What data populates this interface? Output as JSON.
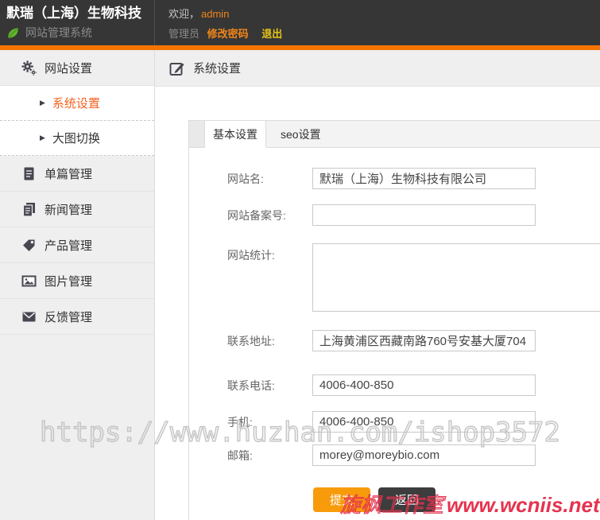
{
  "header": {
    "company": "默瑞（上海）生物科技",
    "system_name": "网站管理系统",
    "welcome_prefix": "欢迎，",
    "username": "admin",
    "role": "管理员",
    "change_password": "修改密码",
    "logout": "退出"
  },
  "colors": {
    "accent_orange": "#f57403",
    "active_link_orange": "#f4621f",
    "submit_button_orange": "#f89b0b",
    "back_button_dark": "#3d3d3d",
    "logout_yellow": "#e6c319",
    "watermark_red": "#e5334f",
    "leaf_green": "#63b32b"
  },
  "sidebar": {
    "items": [
      {
        "label": "网站设置",
        "icon": "gears-icon",
        "type": "menu"
      },
      {
        "label": "系统设置",
        "icon": "arrow-icon",
        "type": "submenu",
        "active": true
      },
      {
        "label": "大图切换",
        "icon": "arrow-icon",
        "type": "submenu",
        "active": false
      },
      {
        "label": "单篇管理",
        "icon": "document-icon",
        "type": "menu"
      },
      {
        "label": "新闻管理",
        "icon": "news-icon",
        "type": "menu"
      },
      {
        "label": "产品管理",
        "icon": "tag-icon",
        "type": "menu"
      },
      {
        "label": "图片管理",
        "icon": "image-icon",
        "type": "menu"
      },
      {
        "label": "反馈管理",
        "icon": "mail-icon",
        "type": "menu"
      }
    ],
    "arrow_glyph": "▶"
  },
  "main": {
    "page_title": "系统设置",
    "tabs": [
      {
        "label": "基本设置",
        "active": true
      },
      {
        "label": "seo设置",
        "active": false
      }
    ],
    "form": {
      "fields": [
        {
          "label": "网站名:",
          "value": "默瑞（上海）生物科技有限公司",
          "type": "text"
        },
        {
          "label": "网站备案号:",
          "value": "",
          "type": "text"
        },
        {
          "label": "网站统计:",
          "value": "",
          "type": "textarea"
        },
        {
          "label": "联系地址:",
          "value": "上海黄浦区西藏南路760号安基大厦704",
          "type": "text"
        },
        {
          "label": "联系电话:",
          "value": "4006-400-850",
          "type": "text"
        },
        {
          "label": "手机:",
          "value": "4006-400-850",
          "type": "text"
        },
        {
          "label": "邮箱:",
          "value": "morey@moreybio.com",
          "type": "text"
        }
      ],
      "submit_label": "提交",
      "back_label": "返回"
    }
  },
  "watermarks": {
    "huzhan": "https://www.huzhan.com/ishop3572",
    "studio": "旋枫工作室",
    "studio_site": "www.wcniis.net"
  }
}
